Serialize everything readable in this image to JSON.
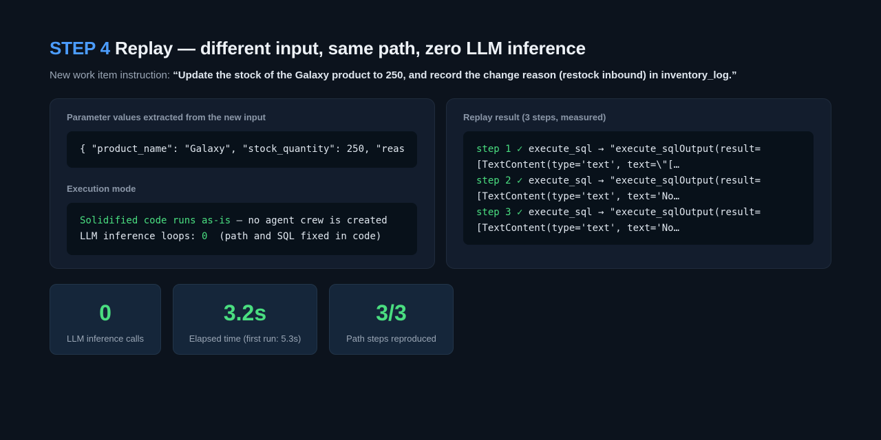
{
  "header": {
    "step_label": "STEP 4",
    "title": "Replay — different input, same path, zero LLM inference",
    "instruction_prefix": "New work item instruction:",
    "instruction_quote": "“Update the stock of the Galaxy product to 250, and record the change reason (restock inbound) in inventory_log.”"
  },
  "left_panel": {
    "params_label": "Parameter values extracted from the new input",
    "params_code": "{ \"product_name\": \"Galaxy\", \"stock_quantity\": 250, \"reas",
    "mode_label": "Execution mode",
    "mode_line1_highlight": "Solidified code runs as-is",
    "mode_line1_rest": " — no agent crew is created",
    "mode_line2_prefix": "LLM inference loops: ",
    "mode_line2_value": "0",
    "mode_line2_suffix": "  (path and SQL fixed in code)"
  },
  "right_panel": {
    "label": "Replay result (3 steps, measured)",
    "steps": [
      {
        "prefix": "step 1 ✓",
        "line1": " execute_sql → \"execute_sqlOutput(result=",
        "line2": "[TextContent(type='text', text=\\\"[…"
      },
      {
        "prefix": "step 2 ✓",
        "line1": " execute_sql → \"execute_sqlOutput(result=",
        "line2": "[TextContent(type='text', text='No…"
      },
      {
        "prefix": "step 3 ✓",
        "line1": " execute_sql → \"execute_sqlOutput(result=",
        "line2": "[TextContent(type='text', text='No…"
      }
    ]
  },
  "stats": [
    {
      "value": "0",
      "label": "LLM inference calls"
    },
    {
      "value": "3.2s",
      "label": "Elapsed time (first run: 5.3s)"
    },
    {
      "value": "3/3",
      "label": "Path steps reproduced"
    }
  ],
  "colors": {
    "accent_blue": "#4c9dff",
    "accent_green": "#4ade80",
    "background": "#0c131d"
  }
}
